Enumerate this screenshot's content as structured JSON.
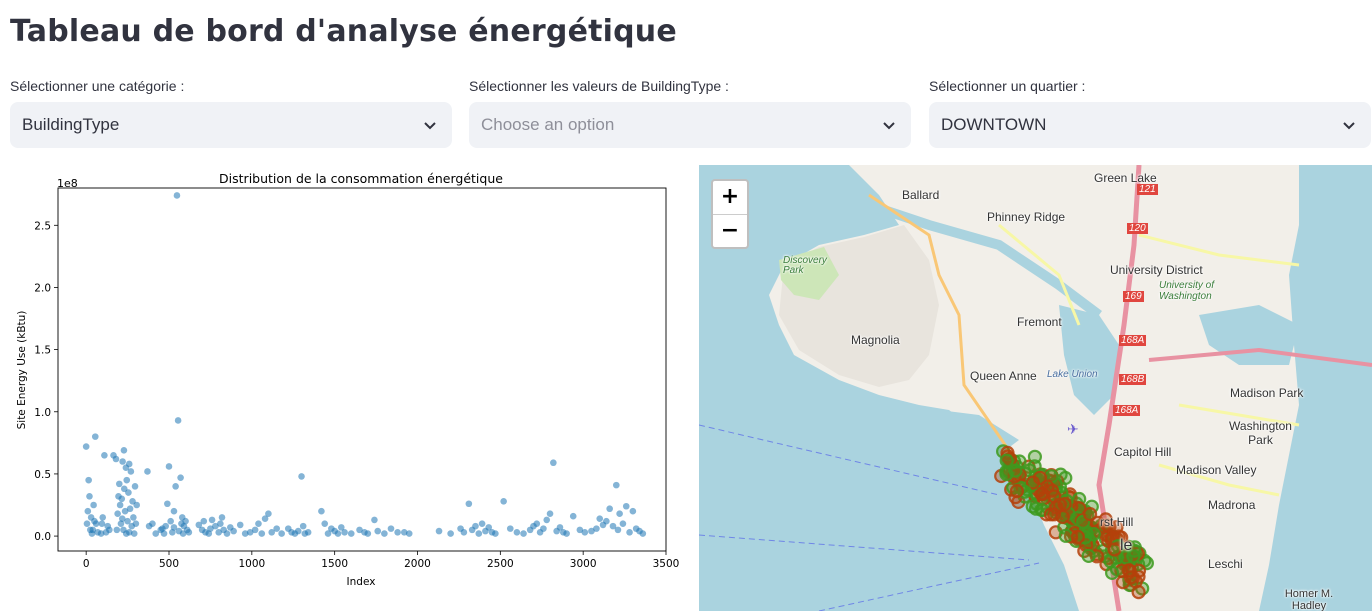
{
  "page": {
    "title": "Tableau de bord d'analyse énergétique"
  },
  "filters": {
    "category": {
      "label": "Sélectionner une catégorie :",
      "value": "BuildingType"
    },
    "building_type": {
      "label": "Sélectionner les valeurs de BuildingType :",
      "placeholder": "Choose an option"
    },
    "neighborhood": {
      "label": "Sélectionner un quartier :",
      "value": "DOWNTOWN"
    }
  },
  "chart_data": {
    "type": "scatter",
    "title": "Distribution de la consommation énergétique",
    "xlabel": "Index",
    "ylabel": "Site Energy Use (kBtu)",
    "y_offset_label": "1e8",
    "xlim": [
      -170,
      3500
    ],
    "ylim": [
      -0.12,
      2.8
    ],
    "x_ticks": [
      0,
      500,
      1000,
      1500,
      2000,
      2500,
      3000,
      3500
    ],
    "y_ticks": [
      0.0,
      0.5,
      1.0,
      1.5,
      2.0,
      2.5
    ],
    "color": "#1f77b4",
    "points": [
      [
        0,
        0.72
      ],
      [
        15,
        0.45
      ],
      [
        20,
        0.32
      ],
      [
        10,
        0.2
      ],
      [
        5,
        0.1
      ],
      [
        30,
        0.15
      ],
      [
        40,
        0.05
      ],
      [
        55,
        0.8
      ],
      [
        25,
        0.05
      ],
      [
        60,
        0.1
      ],
      [
        45,
        0.25
      ],
      [
        70,
        0.03
      ],
      [
        35,
        0.02
      ],
      [
        50,
        0.12
      ],
      [
        110,
        0.65
      ],
      [
        130,
        0.08
      ],
      [
        95,
        0.1
      ],
      [
        120,
        0.03
      ],
      [
        100,
        0.15
      ],
      [
        90,
        0.02
      ],
      [
        140,
        0.05
      ],
      [
        165,
        0.65
      ],
      [
        180,
        0.62
      ],
      [
        190,
        0.18
      ],
      [
        200,
        0.42
      ],
      [
        205,
        0.25
      ],
      [
        210,
        0.1
      ],
      [
        215,
        0.3
      ],
      [
        220,
        0.6
      ],
      [
        225,
        0.05
      ],
      [
        230,
        0.38
      ],
      [
        235,
        0.2
      ],
      [
        240,
        0.55
      ],
      [
        245,
        0.45
      ],
      [
        250,
        0.12
      ],
      [
        255,
        0.35
      ],
      [
        260,
        0.03
      ],
      [
        265,
        0.22
      ],
      [
        270,
        0.52
      ],
      [
        275,
        0.08
      ],
      [
        280,
        0.28
      ],
      [
        285,
        0.15
      ],
      [
        290,
        0.02
      ],
      [
        295,
        0.4
      ],
      [
        300,
        0.1
      ],
      [
        305,
        0.25
      ],
      [
        185,
        0.05
      ],
      [
        195,
        0.32
      ],
      [
        228,
        0.69
      ],
      [
        260,
        0.58
      ],
      [
        242,
        0.02
      ],
      [
        218,
        0.14
      ],
      [
        370,
        0.52
      ],
      [
        380,
        0.08
      ],
      [
        400,
        0.1
      ],
      [
        420,
        0.02
      ],
      [
        450,
        0.05
      ],
      [
        480,
        0.08
      ],
      [
        490,
        0.26
      ],
      [
        500,
        0.56
      ],
      [
        510,
        0.12
      ],
      [
        520,
        0.03
      ],
      [
        530,
        0.2
      ],
      [
        540,
        0.4
      ],
      [
        548,
        2.74
      ],
      [
        555,
        0.93
      ],
      [
        560,
        0.04
      ],
      [
        570,
        0.47
      ],
      [
        575,
        0.1
      ],
      [
        580,
        0.15
      ],
      [
        585,
        0.02
      ],
      [
        590,
        0.08
      ],
      [
        600,
        0.12
      ],
      [
        610,
        0.05
      ],
      [
        620,
        0.03
      ],
      [
        470,
        0.02
      ],
      [
        460,
        0.06
      ],
      [
        530,
        0.07
      ],
      [
        680,
        0.09
      ],
      [
        700,
        0.05
      ],
      [
        720,
        0.03
      ],
      [
        740,
        0.02
      ],
      [
        760,
        0.13
      ],
      [
        780,
        0.08
      ],
      [
        800,
        0.03
      ],
      [
        810,
        0.1
      ],
      [
        830,
        0.05
      ],
      [
        850,
        0.02
      ],
      [
        870,
        0.07
      ],
      [
        890,
        0.04
      ],
      [
        710,
        0.12
      ],
      [
        750,
        0.06
      ],
      [
        820,
        0.15
      ],
      [
        930,
        0.09
      ],
      [
        960,
        0.02
      ],
      [
        990,
        0.03
      ],
      [
        1020,
        0.05
      ],
      [
        1040,
        0.1
      ],
      [
        1060,
        0.02
      ],
      [
        1080,
        0.14
      ],
      [
        1100,
        0.18
      ],
      [
        1120,
        0.03
      ],
      [
        1150,
        0.06
      ],
      [
        1180,
        0.02
      ],
      [
        1220,
        0.06
      ],
      [
        1240,
        0.03
      ],
      [
        1260,
        0.02
      ],
      [
        1280,
        0.04
      ],
      [
        1300,
        0.48
      ],
      [
        1310,
        0.08
      ],
      [
        1320,
        0.02
      ],
      [
        1340,
        0.03
      ],
      [
        1420,
        0.2
      ],
      [
        1440,
        0.1
      ],
      [
        1460,
        0.02
      ],
      [
        1480,
        0.06
      ],
      [
        1500,
        0.04
      ],
      [
        1520,
        0.02
      ],
      [
        1540,
        0.07
      ],
      [
        1560,
        0.03
      ],
      [
        1600,
        0.02
      ],
      [
        1650,
        0.05
      ],
      [
        1680,
        0.03
      ],
      [
        1700,
        0.02
      ],
      [
        1740,
        0.13
      ],
      [
        1760,
        0.04
      ],
      [
        1800,
        0.02
      ],
      [
        1840,
        0.06
      ],
      [
        1880,
        0.03
      ],
      [
        1920,
        0.03
      ],
      [
        1950,
        0.02
      ],
      [
        2130,
        0.04
      ],
      [
        2200,
        0.02
      ],
      [
        2260,
        0.06
      ],
      [
        2280,
        0.03
      ],
      [
        2310,
        0.26
      ],
      [
        2330,
        0.05
      ],
      [
        2350,
        0.08
      ],
      [
        2370,
        0.02
      ],
      [
        2390,
        0.1
      ],
      [
        2410,
        0.04
      ],
      [
        2430,
        0.07
      ],
      [
        2450,
        0.03
      ],
      [
        2470,
        0.02
      ],
      [
        2520,
        0.28
      ],
      [
        2560,
        0.06
      ],
      [
        2600,
        0.03
      ],
      [
        2640,
        0.02
      ],
      [
        2680,
        0.05
      ],
      [
        2700,
        0.08
      ],
      [
        2720,
        0.1
      ],
      [
        2740,
        0.03
      ],
      [
        2760,
        0.06
      ],
      [
        2780,
        0.13
      ],
      [
        2800,
        0.18
      ],
      [
        2820,
        0.59
      ],
      [
        2840,
        0.04
      ],
      [
        2860,
        0.07
      ],
      [
        2880,
        0.03
      ],
      [
        2900,
        0.02
      ],
      [
        2940,
        0.16
      ],
      [
        2980,
        0.05
      ],
      [
        3010,
        0.03
      ],
      [
        3050,
        0.04
      ],
      [
        3080,
        0.06
      ],
      [
        3100,
        0.14
      ],
      [
        3120,
        0.09
      ],
      [
        3140,
        0.12
      ],
      [
        3160,
        0.22
      ],
      [
        3180,
        0.08
      ],
      [
        3200,
        0.41
      ],
      [
        3210,
        0.05
      ],
      [
        3220,
        0.18
      ],
      [
        3240,
        0.1
      ],
      [
        3260,
        0.24
      ],
      [
        3280,
        0.03
      ],
      [
        3300,
        0.2
      ],
      [
        3320,
        0.06
      ],
      [
        3340,
        0.04
      ],
      [
        3360,
        0.02
      ]
    ]
  },
  "map": {
    "zoom_in": "+",
    "zoom_out": "−",
    "labels": {
      "ballard": "Ballard",
      "green_lake": "Green Lake",
      "phinney_ridge": "Phinney Ridge",
      "discovery_park": "Discovery Park",
      "university_district": "University District",
      "university_of_washington": "University of Washington",
      "fremont": "Fremont",
      "magnolia": "Magnolia",
      "queen_anne": "Queen Anne",
      "lake_union": "Lake Union",
      "madison_park": "Madison Park",
      "washington_park": "Washington Park",
      "capitol_hill": "Capitol Hill",
      "madison_valley": "Madison Valley",
      "madrona": "Madrona",
      "first_hill": "rst Hill",
      "seattle_fragment": "le",
      "leschi": "Leschi",
      "homer_hadley": "Homer M. Hadley"
    },
    "highways": {
      "h121": "121",
      "h120": "120",
      "h169": "169",
      "h168a": "168A",
      "h168b": "168B",
      "h168a2": "168A"
    },
    "marker_colors": [
      "#3d9a1f",
      "#b4410a"
    ]
  }
}
